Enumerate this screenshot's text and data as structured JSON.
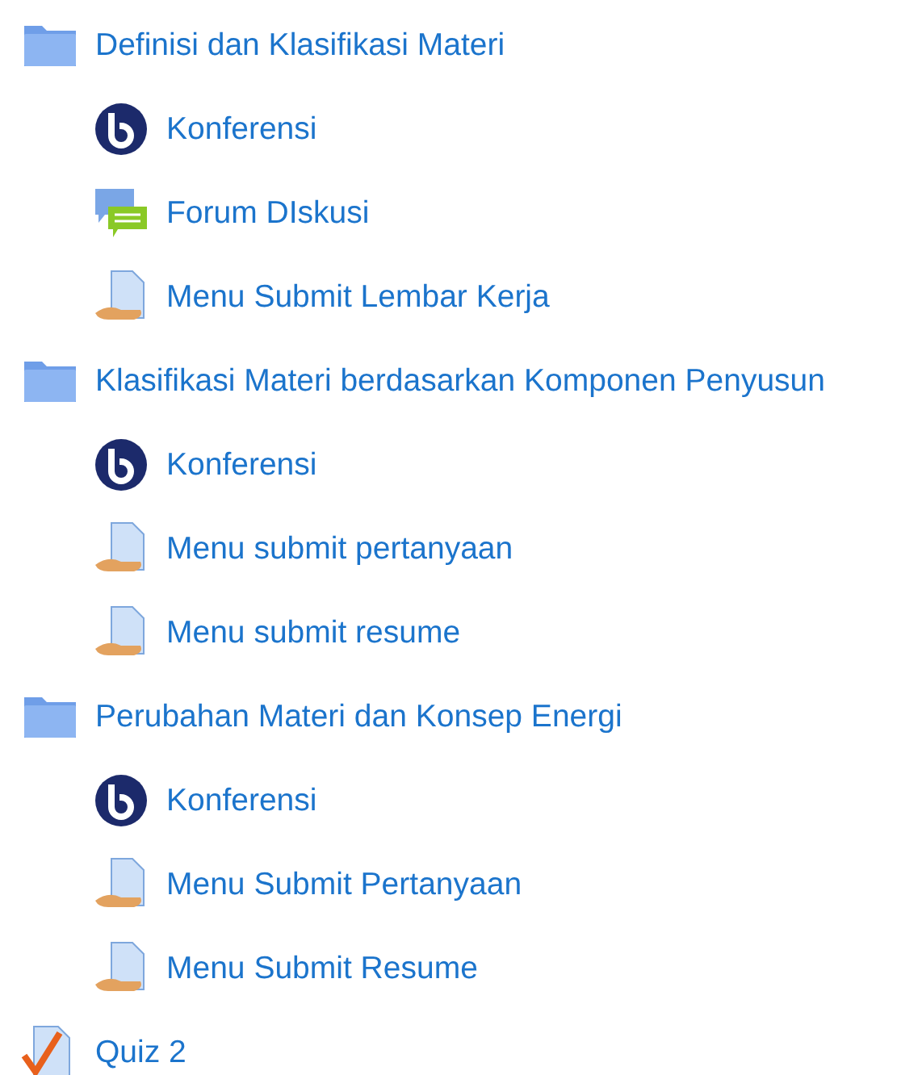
{
  "items": [
    {
      "kind": "folder",
      "label": "Definisi dan Klasifikasi Materi",
      "children": [
        {
          "kind": "conference",
          "label": "Konferensi"
        },
        {
          "kind": "forum",
          "label": "Forum DIskusi"
        },
        {
          "kind": "assignment",
          "label": "Menu Submit Lembar Kerja"
        }
      ]
    },
    {
      "kind": "folder",
      "label": "Klasifikasi Materi berdasarkan Komponen Penyusun",
      "children": [
        {
          "kind": "conference",
          "label": "Konferensi"
        },
        {
          "kind": "assignment",
          "label": "Menu submit pertanyaan"
        },
        {
          "kind": "assignment",
          "label": "Menu submit resume"
        }
      ]
    },
    {
      "kind": "folder",
      "label": "Perubahan Materi dan Konsep Energi",
      "children": [
        {
          "kind": "conference",
          "label": "Konferensi"
        },
        {
          "kind": "assignment",
          "label": "Menu Submit Pertanyaan"
        },
        {
          "kind": "assignment",
          "label": "Menu Submit Resume"
        }
      ]
    },
    {
      "kind": "quiz",
      "label": "Quiz 2"
    }
  ]
}
